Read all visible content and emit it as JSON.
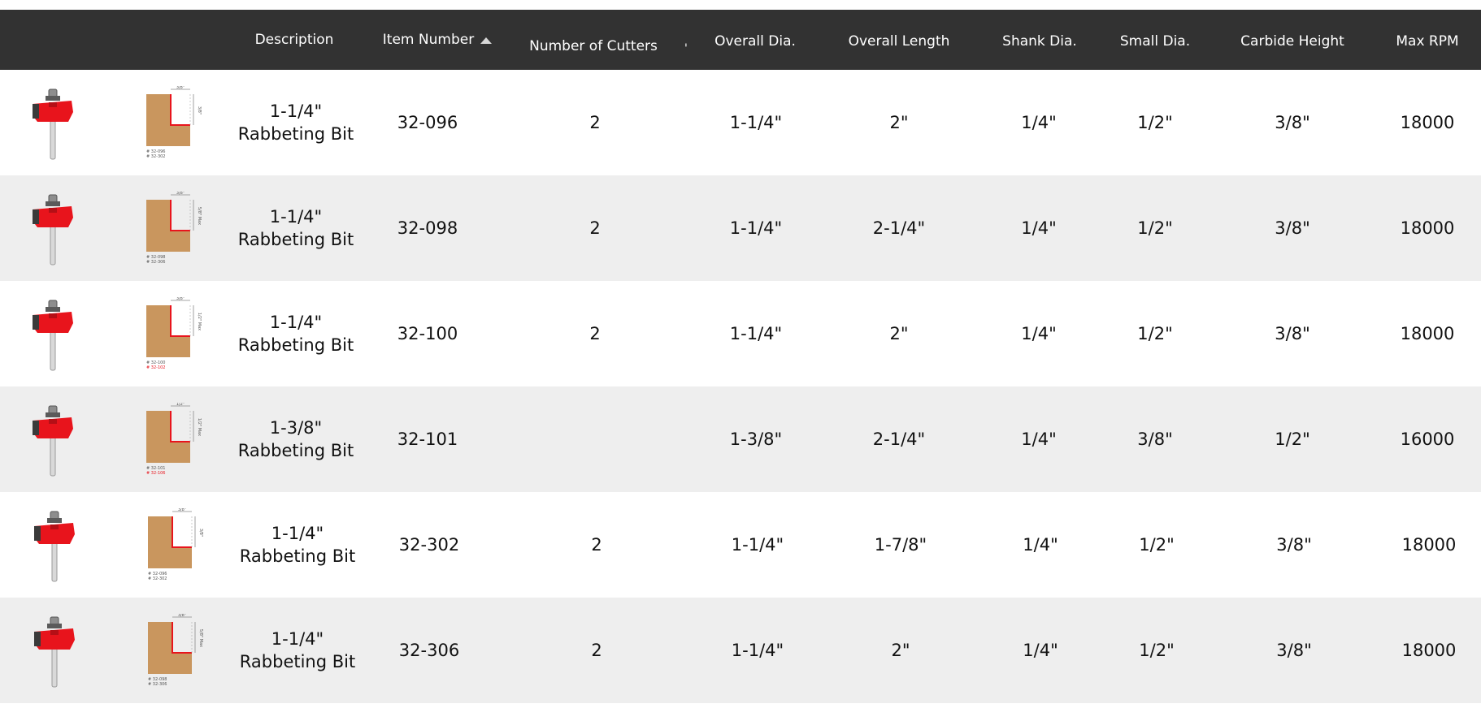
{
  "columns": {
    "description": "Description",
    "item_number": "Item Number",
    "cutters": "Number of Cutters",
    "tick": "'",
    "overall_dia": "Overall Dia.",
    "overall_length": "Overall Length",
    "shank_dia": "Shank Dia.",
    "small_dia": "Small Dia.",
    "carbide_height": "Carbide Height",
    "max_rpm": "Max RPM"
  },
  "rows": [
    {
      "desc1": "1-1/4\"",
      "desc2": "Rabbeting Bit",
      "item": "32-096",
      "cutters": "2",
      "od": "1-1/4\"",
      "ol": "2\"",
      "sd": "1/4\"",
      "smd": "1/2\"",
      "ch": "3/8\"",
      "rpm": "18000",
      "prof_top": "3/8\"",
      "prof_side": "3/8\"",
      "prof_codes": [
        "# 32-096",
        "# 32-302"
      ]
    },
    {
      "desc1": "1-1/4\"",
      "desc2": "Rabbeting Bit",
      "item": "32-098",
      "cutters": "2",
      "od": "1-1/4\"",
      "ol": "2-1/4\"",
      "sd": "1/4\"",
      "smd": "1/2\"",
      "ch": "3/8\"",
      "rpm": "18000",
      "prof_top": "3/8\"",
      "prof_side": "5/8\" Max",
      "prof_codes": [
        "# 32-098",
        "# 32-306"
      ]
    },
    {
      "desc1": "1-1/4\"",
      "desc2": "Rabbeting Bit",
      "item": "32-100",
      "cutters": "2",
      "od": "1-1/4\"",
      "ol": "2\"",
      "sd": "1/4\"",
      "smd": "1/2\"",
      "ch": "3/8\"",
      "rpm": "18000",
      "prof_top": "3/8\"",
      "prof_side": "1/2\" Max",
      "prof_codes": [
        "# 32-100",
        "# 32-102"
      ]
    },
    {
      "desc1": "1-3/8\"",
      "desc2": "Rabbeting Bit",
      "item": "32-101",
      "cutters": "",
      "od": "1-3/8\"",
      "ol": "2-1/4\"",
      "sd": "1/4\"",
      "smd": "3/8\"",
      "ch": "1/2\"",
      "rpm": "16000",
      "prof_top": "1/2\"",
      "prof_side": "1/2\" Max",
      "prof_codes": [
        "# 32-101",
        "# 32-106"
      ]
    },
    {
      "desc1": "1-1/4\"",
      "desc2": "Rabbeting Bit",
      "item": "32-302",
      "cutters": "2",
      "od": "1-1/4\"",
      "ol": "1-7/8\"",
      "sd": "1/4\"",
      "smd": "1/2\"",
      "ch": "3/8\"",
      "rpm": "18000",
      "prof_top": "3/8\"",
      "prof_side": "3/8\"",
      "prof_codes": [
        "# 32-096",
        "# 32-302"
      ]
    },
    {
      "desc1": "1-1/4\"",
      "desc2": "Rabbeting Bit",
      "item": "32-306",
      "cutters": "2",
      "od": "1-1/4\"",
      "ol": "2\"",
      "sd": "1/4\"",
      "smd": "1/2\"",
      "ch": "3/8\"",
      "rpm": "18000",
      "prof_top": "3/8\"",
      "prof_side": "5/8\" Max",
      "prof_codes": [
        "# 32-098",
        "# 32-306"
      ]
    }
  ],
  "colors": {
    "header_bg": "#323232",
    "alt_row": "#eeeeee",
    "bit_red": "#e8141c",
    "wood": "#c9965e"
  }
}
